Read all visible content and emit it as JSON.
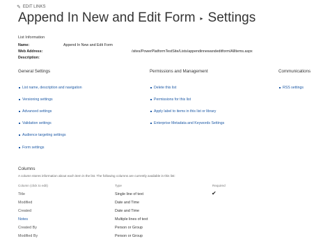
{
  "edit_links": {
    "label": "EDIT LINKS",
    "icon": "pencil-icon"
  },
  "title": {
    "list_name": "Append In New and Edit Form",
    "separator": "▸",
    "page": "Settings"
  },
  "list_info": {
    "heading": "List Information",
    "name_label": "Name:",
    "name_value": "Append In New and Edit Form",
    "web_label": "Web Address:",
    "web_value": "/sites/PowerPlatformTestSite/Lists/appendinnewandeditform/AllItems.aspx",
    "desc_label": "Description:"
  },
  "groups": {
    "general": {
      "heading": "General Settings",
      "links": [
        "List name, description and navigation",
        "Versioning settings",
        "Advanced settings",
        "Validation settings",
        "Audience targeting settings",
        "Form settings"
      ]
    },
    "permissions": {
      "heading": "Permissions and Management",
      "links": [
        "Delete this list",
        "Permissions for this list",
        "Apply label to items in this list or library",
        "Enterprise Metadata and Keywords Settings"
      ]
    },
    "communications": {
      "heading": "Communications",
      "links": [
        "RSS settings"
      ]
    }
  },
  "columns": {
    "heading": "Columns",
    "description": "A column stores information about each item in the list. The following columns are currently available in this list:",
    "headers": {
      "name": "Column (click to edit)",
      "type": "Type",
      "required": "Required"
    },
    "rows": [
      {
        "name": "Title",
        "type": "Single line of text",
        "required": true,
        "is_link": false
      },
      {
        "name": "Modified",
        "type": "Date and Time",
        "required": false,
        "is_link": false
      },
      {
        "name": "Created",
        "type": "Date and Time",
        "required": false,
        "is_link": false
      },
      {
        "name": "Notes",
        "type": "Multiple lines of text",
        "required": false,
        "is_link": true
      },
      {
        "name": "Created By",
        "type": "Person or Group",
        "required": false,
        "is_link": false
      },
      {
        "name": "Modified By",
        "type": "Person or Group",
        "required": false,
        "is_link": false
      }
    ],
    "check_glyph": "✔"
  },
  "colors": {
    "link": "#1e5aa6",
    "text": "#333333"
  }
}
